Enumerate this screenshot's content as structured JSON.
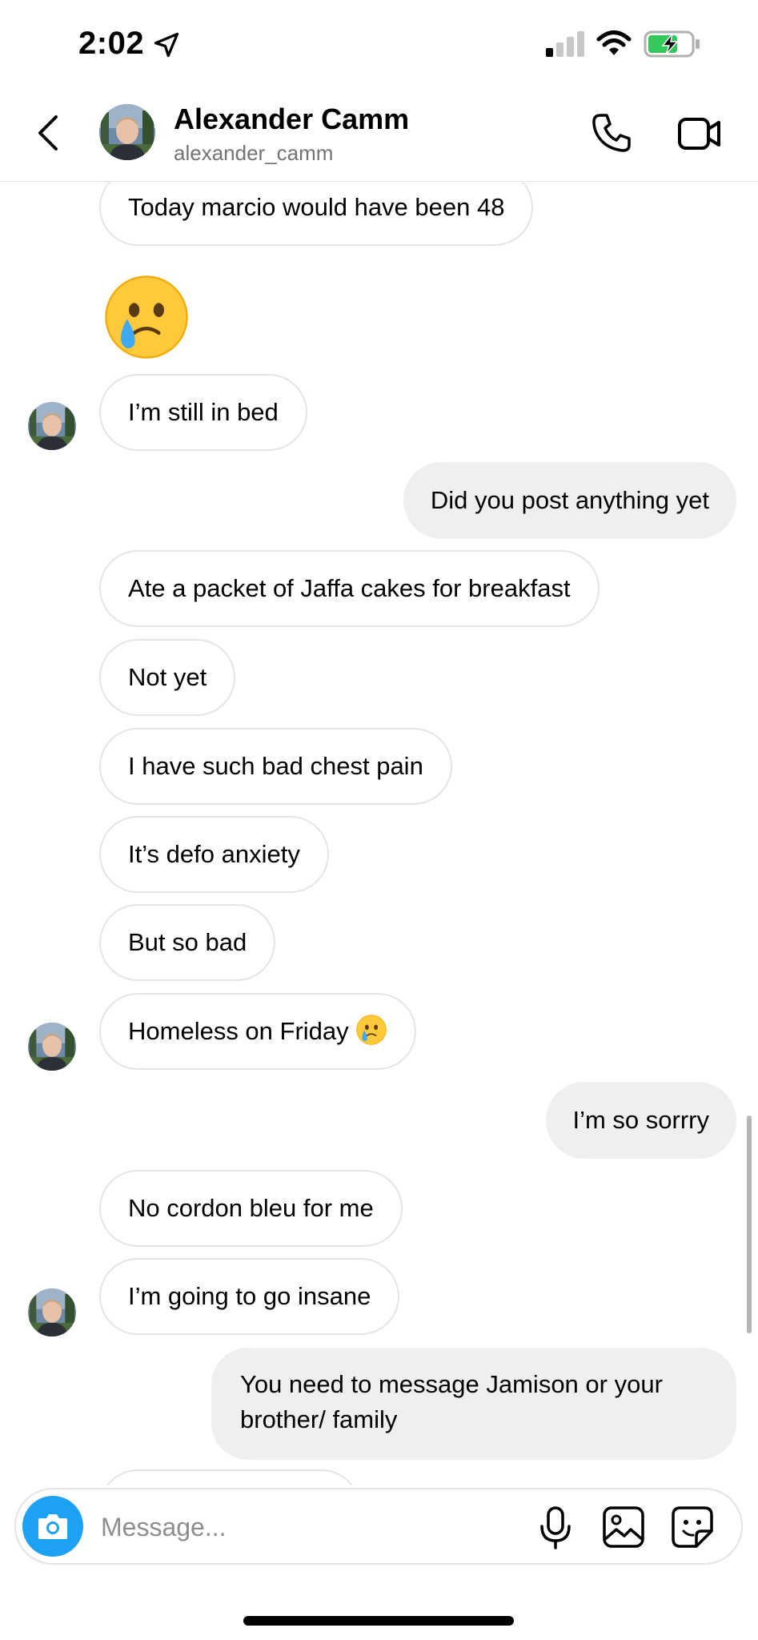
{
  "status_bar": {
    "time": "2:02"
  },
  "header": {
    "name": "Alexander Camm",
    "username": "alexander_camm"
  },
  "messages": [
    {
      "dir": "in",
      "text": "Today marcio would have been 48"
    },
    {
      "dir": "in",
      "emoji": "face-holding-back-tears"
    },
    {
      "dir": "in",
      "text": "I’m still in bed"
    },
    {
      "dir": "out",
      "text": "Did you post anything yet"
    },
    {
      "dir": "in",
      "text": "Ate a packet of Jaffa cakes for breakfast"
    },
    {
      "dir": "in",
      "text": "Not yet"
    },
    {
      "dir": "in",
      "text": "I have such bad chest pain"
    },
    {
      "dir": "in",
      "text": "It’s defo anxiety"
    },
    {
      "dir": "in",
      "text": "But so bad"
    },
    {
      "dir": "in",
      "text": "Homeless on Friday",
      "emoji": "face-holding-back-tears"
    },
    {
      "dir": "out",
      "text": "I’m so sorrry"
    },
    {
      "dir": "in",
      "text": "No cordon bleu for me"
    },
    {
      "dir": "in",
      "text": "I’m going to go insane"
    },
    {
      "dir": "out",
      "text": "You need to message Jamison or your brother/ family"
    }
  ],
  "composer": {
    "placeholder": "Message..."
  },
  "colors": {
    "incoming_border": "#e5e5e5",
    "outgoing_bg": "#efefef",
    "camera_button": "#1da1f2",
    "secondary_text": "#737373"
  }
}
